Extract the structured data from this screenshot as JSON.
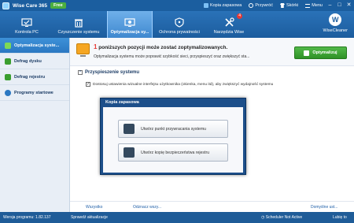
{
  "app": {
    "title": "Wise Care 365",
    "edition_badge": "Free"
  },
  "top_links": {
    "backup": "Kopia zapasowa",
    "feedback": "Przywróć",
    "shortcuts": "Skórki",
    "menu": "Menu"
  },
  "nav": {
    "tabs": [
      {
        "label": "Kontrola PC",
        "icon": "monitor-check-icon"
      },
      {
        "label": "Czyszczenie systemu",
        "icon": "trash-icon"
      },
      {
        "label": "Optymalizacja sy...",
        "icon": "optimize-monitor-icon"
      },
      {
        "label": "Ochrona prywatności",
        "icon": "shield-icon"
      },
      {
        "label": "Narzędzia Wise",
        "icon": "tools-icon",
        "badge": "4"
      }
    ],
    "brand_label": "WiseCleaner"
  },
  "sidebar": {
    "items": [
      {
        "label": "Optymalizacja syste..."
      },
      {
        "label": "Defrag dysku"
      },
      {
        "label": "Defrag rejestru"
      },
      {
        "label": "Programy startowe"
      }
    ]
  },
  "main": {
    "headline_num": "1",
    "headline_text": "poniższych pozycji może zostać zoptymalizowanych.",
    "subline": "Optymalizacja systemu może poprawić szybkość sieci, przyspieszyć oraz zwiększyć sta...",
    "optimize_button": "Optymalizuj",
    "section_title": "Przyspieszenie systemu",
    "check_item": "Dostosuj ustawienia wizualne interfejsu użytkownika (okienka, menu itd), aby zwiększyć wydajność systemu",
    "check_all": "Wszystko",
    "uncheck_all": "Odznacz wszy...",
    "default": "Domyślne ust..."
  },
  "modal": {
    "title": "Kopia zapasowa",
    "btn_restore_point": "Utwórz punkt przywracania systemu",
    "btn_registry_backup": "Utwórz kopię bezpieczeństwa rejestru"
  },
  "statusbar": {
    "version": "Wersja programu: 1.82.137",
    "check_updates": "Sprawdź aktualizacje",
    "scheduler": "Scheduler Not Active",
    "like": "Lubię to"
  },
  "colors": {
    "brand_blue": "#1c5d9e",
    "accent_green": "#3a9e2f",
    "headline_red": "#e53935"
  }
}
